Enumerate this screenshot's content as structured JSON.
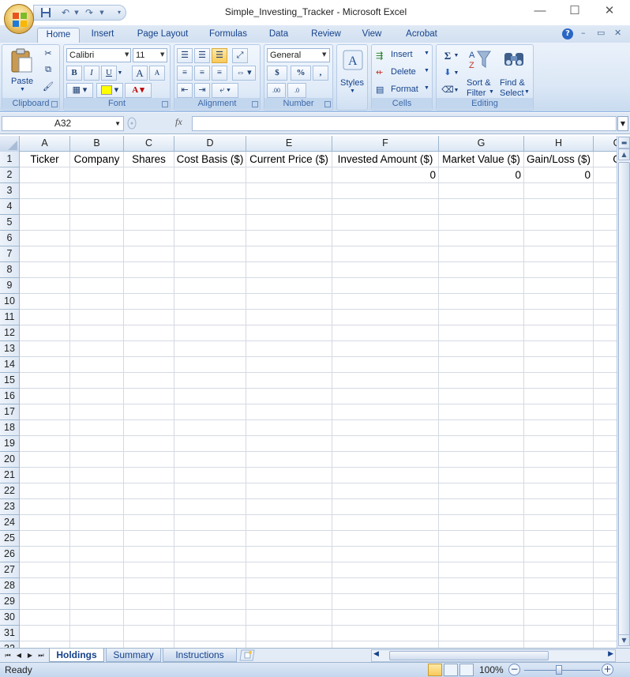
{
  "window": {
    "title": "Simple_Investing_Tracker - Microsoft Excel",
    "minimize": "—",
    "maximize": "☐",
    "close": "✕"
  },
  "ribbon_tabs": [
    "Home",
    "Insert",
    "Page Layout",
    "Formulas",
    "Data",
    "Review",
    "View",
    "Acrobat"
  ],
  "active_tab": "Home",
  "clipboard": {
    "paste": "Paste",
    "label": "Clipboard"
  },
  "font": {
    "name": "Calibri",
    "size": "11",
    "label": "Font",
    "bold": "B",
    "italic": "I",
    "underline": "U",
    "grow": "A",
    "shrink": "A"
  },
  "alignment": {
    "label": "Alignment"
  },
  "number": {
    "format": "General",
    "currency": "$",
    "percent": "%",
    "comma": ",",
    "inc_decimal": ".00",
    "dec_decimal": ".0",
    "label": "Number"
  },
  "styles": {
    "label": "Styles"
  },
  "cells": {
    "insert": "Insert",
    "delete": "Delete",
    "format": "Format",
    "label": "Cells"
  },
  "editing": {
    "sort_line1": "Sort &",
    "sort_line2": "Filter",
    "find_line1": "Find &",
    "find_line2": "Select",
    "label": "Editing"
  },
  "formula_bar": {
    "name_box": "A32",
    "fx": "fx",
    "formula": ""
  },
  "sheet": {
    "columns": [
      "A",
      "B",
      "C",
      "D",
      "E",
      "F",
      "G",
      "H",
      "G"
    ],
    "rows": [
      [
        "Ticker",
        "Company",
        "Shares",
        "Cost Basis ($)",
        "Current Price ($)",
        "Invested Amount ($)",
        "Market Value ($)",
        "Gain/Loss ($)",
        "G"
      ],
      [
        "",
        "",
        "",
        "",
        "",
        "0",
        "0",
        "0",
        ""
      ]
    ],
    "row_numbers": [
      "1",
      "2",
      "3",
      "4",
      "5",
      "6",
      "7",
      "8",
      "9",
      "10",
      "11",
      "12",
      "13",
      "14",
      "15",
      "16",
      "17",
      "18",
      "19",
      "20",
      "21",
      "22",
      "23",
      "24",
      "25",
      "26",
      "27",
      "28",
      "29",
      "30",
      "31",
      "32"
    ]
  },
  "sheet_tabs": [
    "Holdings",
    "Summary",
    "Instructions"
  ],
  "active_sheet": "Holdings",
  "status": {
    "text": "Ready",
    "zoom": "100%"
  },
  "colors": {
    "ribbon_text": "#15428b",
    "header_bg": "#dce7f4",
    "accent": "#f9c95a"
  }
}
